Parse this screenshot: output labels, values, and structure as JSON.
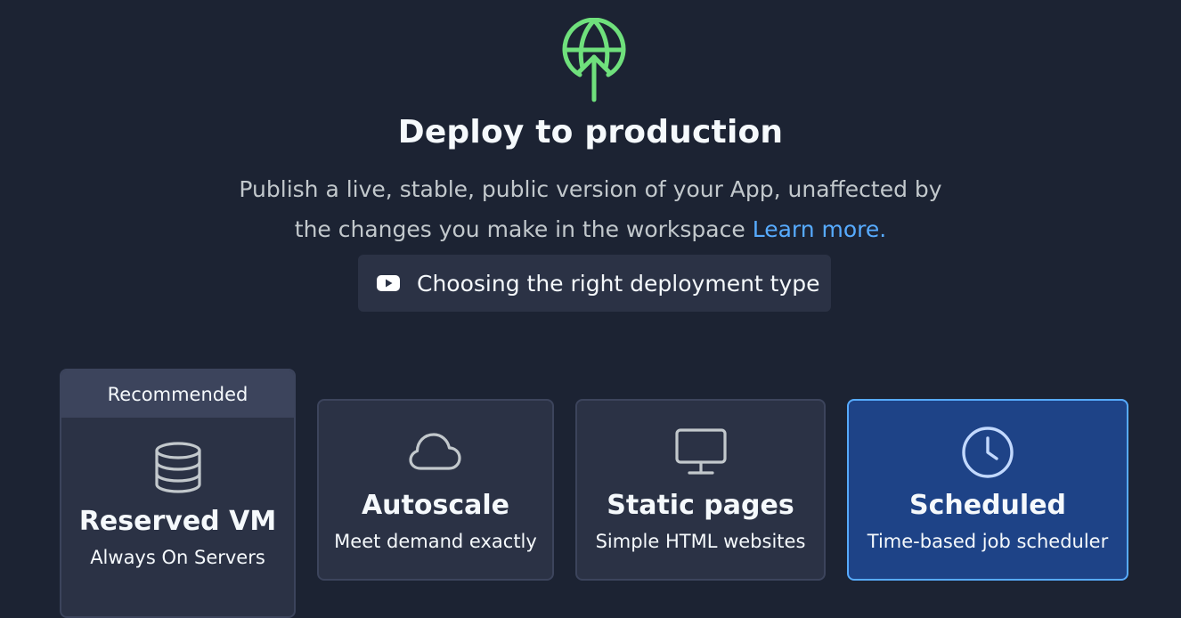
{
  "header": {
    "icon": "globe-upload-icon",
    "title": "Deploy to production",
    "description_line1": "Publish a live, stable, public version of your App, unaffected by",
    "description_line2": "the changes you make in the workspace",
    "learn_more": "Learn more."
  },
  "video_button": {
    "icon": "youtube-icon",
    "label": "Choosing the right deployment type"
  },
  "deployment_types": [
    {
      "name": "Reserved VM",
      "subtitle": "Always On Servers",
      "icon": "database-icon",
      "badge": "Recommended",
      "selected": false
    },
    {
      "name": "Autoscale",
      "subtitle": "Meet demand exactly",
      "icon": "cloud-icon",
      "selected": false
    },
    {
      "name": "Static pages",
      "subtitle": "Simple HTML websites",
      "icon": "monitor-icon",
      "selected": false
    },
    {
      "name": "Scheduled",
      "subtitle": "Time-based job scheduler",
      "icon": "clock-icon",
      "selected": true
    }
  ],
  "colors": {
    "background": "#1c2333",
    "surface": "#2b3245",
    "accent_green": "#6fe07c",
    "link_blue": "#57abff",
    "selected_bg": "#1e4387"
  }
}
